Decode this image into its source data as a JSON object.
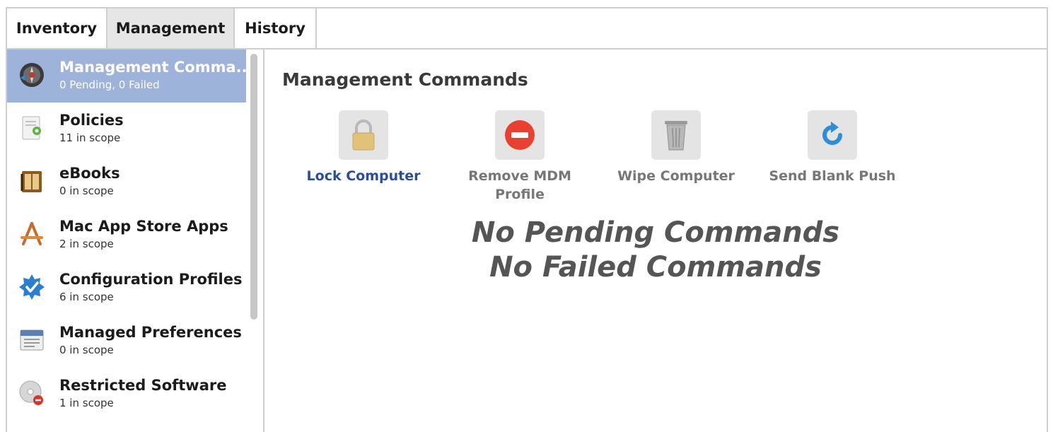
{
  "tabs": [
    {
      "label": "Inventory"
    },
    {
      "label": "Management"
    },
    {
      "label": "History"
    }
  ],
  "sidebar": {
    "items": [
      {
        "title": "Management Comma...",
        "sub": "0 Pending, 0 Failed",
        "icon": "management-commands-icon"
      },
      {
        "title": "Policies",
        "sub": "11 in scope",
        "icon": "policies-icon"
      },
      {
        "title": "eBooks",
        "sub": "0 in scope",
        "icon": "ebooks-icon"
      },
      {
        "title": "Mac App Store Apps",
        "sub": "2 in scope",
        "icon": "app-store-icon"
      },
      {
        "title": "Configuration Profiles",
        "sub": "6 in scope",
        "icon": "configuration-profile-icon"
      },
      {
        "title": "Managed Preferences",
        "sub": "0 in scope",
        "icon": "managed-preferences-icon"
      },
      {
        "title": "Restricted Software",
        "sub": "1 in scope",
        "icon": "restricted-software-icon"
      }
    ]
  },
  "main": {
    "title": "Management Commands",
    "commands": [
      {
        "label": "Lock Computer",
        "icon": "lock-icon"
      },
      {
        "label": "Remove MDM Profile",
        "icon": "remove-icon"
      },
      {
        "label": "Wipe Computer",
        "icon": "trash-icon"
      },
      {
        "label": "Send Blank Push",
        "icon": "refresh-icon"
      }
    ],
    "status_pending": "No Pending Commands",
    "status_failed": "No Failed Commands"
  },
  "colors": {
    "selected_row": "#9db3d9",
    "active_tab": "#e6e6e6",
    "link": "#2a4d9c",
    "remove_red": "#e8412f",
    "refresh_blue": "#2a8fd8"
  }
}
